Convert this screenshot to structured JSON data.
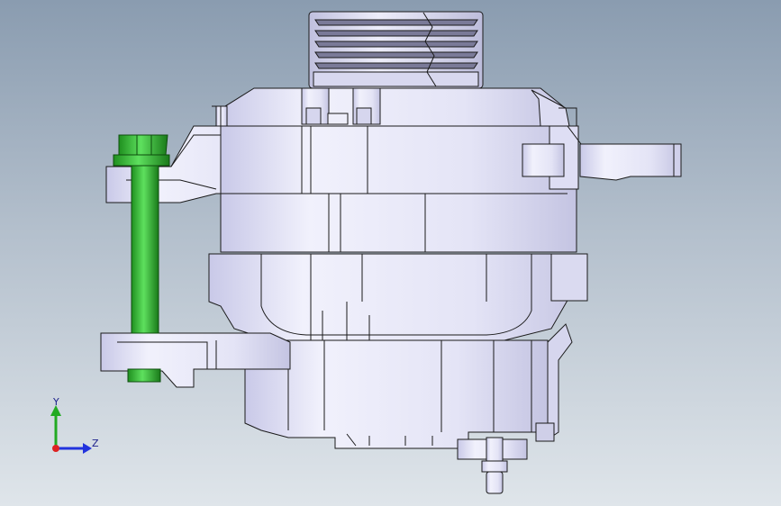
{
  "viewport": {
    "background_top": "#8a9cb0",
    "background_bottom": "#dfe5ea"
  },
  "model": {
    "body_color": "#e6e6f8",
    "body_shade": "#c8c8e6",
    "edge_color": "#1a1a1a",
    "bolt_color": "#33cc33",
    "bolt_dark": "#1f8f1f"
  },
  "triad": {
    "y_label": "Y",
    "z_label": "Z",
    "y_color": "#22aa22",
    "z_color": "#2233dd",
    "x_color": "#dd2222"
  }
}
